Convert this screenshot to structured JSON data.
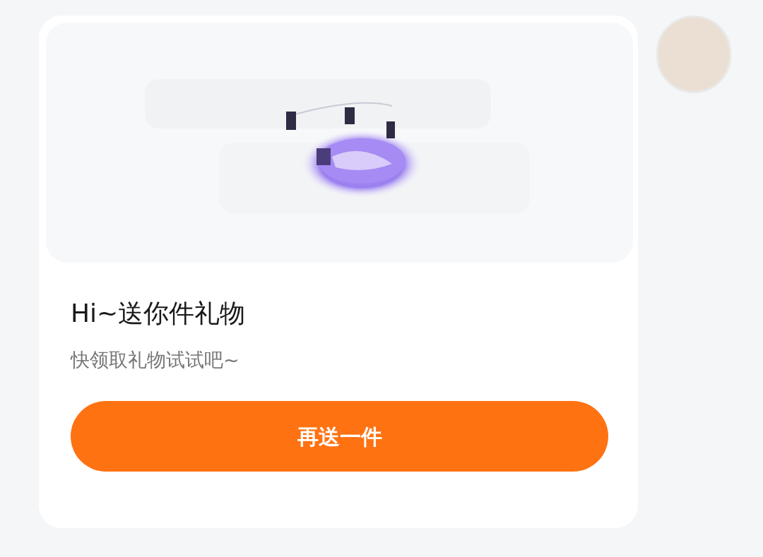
{
  "message": {
    "title": "Hi~送你件礼物",
    "subtitle": "快领取礼物试试吧~",
    "button": "再送一件"
  }
}
